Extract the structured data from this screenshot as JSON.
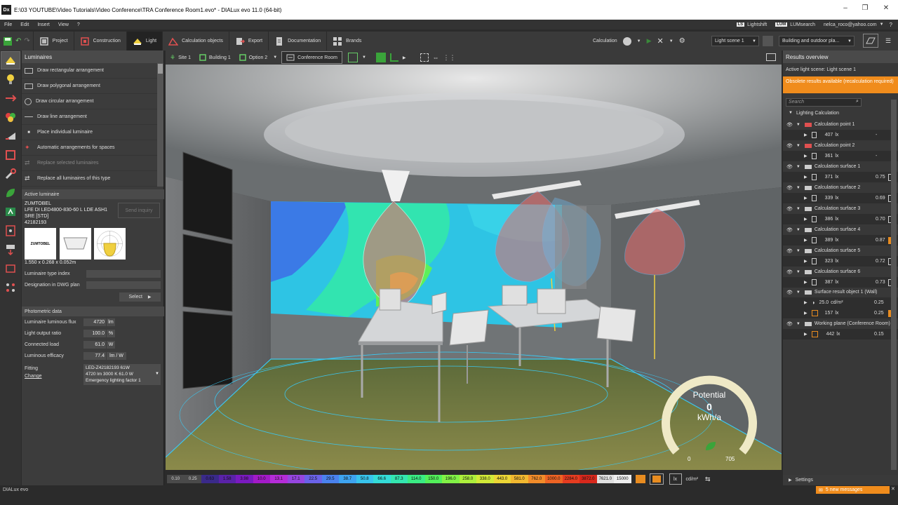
{
  "titlebar": {
    "logo": "Dx",
    "title": "E:\\03 YOUTUBE\\Video Tutorials\\Video Conference\\TRA Conference Room1.evo* - DIALux evo 11.0 (64-bit)"
  },
  "menu": {
    "items": [
      "File",
      "Edit",
      "Insert",
      "View",
      "?"
    ],
    "lightshift_badge": "LS",
    "lightshift": "Lightshift",
    "lumsearch_badge": "LUM",
    "lumsearch": "LUMsearch",
    "user": "nelca_roco@yahoo.com"
  },
  "toolbar": {
    "tabs": [
      {
        "label": "Project"
      },
      {
        "label": "Construction"
      },
      {
        "label": "Light"
      },
      {
        "label": "Calculation objects"
      },
      {
        "label": "Export"
      },
      {
        "label": "Documentation"
      },
      {
        "label": "Brands"
      }
    ],
    "calculation": "Calculation",
    "light_scene": "Light scene 1",
    "mode": "Building and outdoor pla..."
  },
  "luminaires": {
    "header": "Luminaires",
    "actions": [
      "Draw rectangular arrangement",
      "Draw polygonal arrangement",
      "Draw circular arrangement",
      "Draw line arrangement",
      "Place individual luminaire",
      "Automatic arrangements for spaces",
      "Replace selected luminaires",
      "Replace all luminaires of this type"
    ],
    "active_header": "Active luminaire",
    "manufacturer": "ZUMTOBEL",
    "model_line1": "LFE DI LED4800-830-60 L LDE ASH1",
    "model_line2": "SRE [STD]",
    "article": "42182193",
    "send_inquiry": "Send inquiry",
    "logo_text": "ZUMTOBEL",
    "dimensions": "1.550 x 0.268 x 0.052m",
    "type_index_label": "Luminaire type index",
    "designation_label": "Designation in DWG plan",
    "select": "Select",
    "photometric_header": "Photometric data",
    "flux_label": "Luminaire luminous flux",
    "flux": "4720",
    "flux_unit": "lm",
    "lor_label": "Light output ratio",
    "lor": "100.0",
    "lor_unit": "%",
    "load_label": "Connected load",
    "load": "61.0",
    "load_unit": "W",
    "efficacy_label": "Luminous efficacy",
    "efficacy": "77.4",
    "efficacy_unit": "lm / W",
    "fitting_label": "Fitting",
    "change": "Change",
    "fitting_line1": "LED-Z42182193  61W",
    "fitting_line2": "4720 lm  3000 K  61.0 W",
    "fitting_line3": "Emergency lighting factor  1"
  },
  "viewbar": {
    "site": "Site 1",
    "building": "Building 1",
    "option": "Option 2",
    "room": "Conference Room"
  },
  "gauge": {
    "title": "Potential",
    "value": "0",
    "unit": "kWh/a",
    "min": "0",
    "max": "705",
    "level": 0
  },
  "colorbar": {
    "values": [
      "0.10",
      "0.25",
      "0.63",
      "1.58",
      "3.98",
      "10.0",
      "13.1",
      "17.1",
      "22.5",
      "29.5",
      "38.7",
      "50.8",
      "66.6",
      "87.3",
      "114.0",
      "150.0",
      "196.0",
      "258.0",
      "338.0",
      "443.0",
      "581.0",
      "762.0",
      "1000.0",
      "2284.0",
      "3872.0",
      "7621.0",
      "15000"
    ],
    "colors": [
      "#4a4a4a",
      "#4a4a4a",
      "#3a2a8a",
      "#5a22a8",
      "#7a1ac0",
      "#a31ac8",
      "#b52cd8",
      "#9646e0",
      "#6a62e8",
      "#4a82ee",
      "#3ea4f0",
      "#38c4ec",
      "#34dcd8",
      "#34e6b0",
      "#3aec84",
      "#52f05a",
      "#82f246",
      "#aef03c",
      "#d2ea38",
      "#ecd636",
      "#f2b830",
      "#f28c2a",
      "#ee6424",
      "#e63c20",
      "#d8281c",
      "#e0e0e0",
      "#eeeeee"
    ],
    "unit_lx": "lx",
    "unit_cd": "cd/m²"
  },
  "results": {
    "header": "Results overview",
    "active_scene": "Active light scene: Light scene 1",
    "obsolete": "Obsolete results available (recalculation required)",
    "search_placeholder": "Search",
    "group": "Lighting Calculation",
    "items": [
      {
        "name": "Calculation point 1",
        "value": "407",
        "unit": "lx",
        "ratio": "-",
        "status": "none"
      },
      {
        "name": "Calculation point 2",
        "value": "361",
        "unit": "lx",
        "ratio": "-",
        "status": "none"
      },
      {
        "name": "Calculation surface 1",
        "value": "371",
        "unit": "lx",
        "ratio": "0.75",
        "status": "ok"
      },
      {
        "name": "Calculation surface 2",
        "value": "339",
        "unit": "lx",
        "ratio": "0.69",
        "status": "ok"
      },
      {
        "name": "Calculation surface 3",
        "value": "386",
        "unit": "lx",
        "ratio": "0.70",
        "status": "ok"
      },
      {
        "name": "Calculation surface 4",
        "value": "389",
        "unit": "lx",
        "ratio": "0.87",
        "status": "warn"
      },
      {
        "name": "Calculation surface 5",
        "value": "323",
        "unit": "lx",
        "ratio": "0.72",
        "status": "ok"
      },
      {
        "name": "Calculation surface 6",
        "value": "387",
        "unit": "lx",
        "ratio": "0.73",
        "status": "ok"
      }
    ],
    "surface_result": {
      "name": "Surface result object 1 (Wall)",
      "lum_value": "25.0",
      "lum_unit": "cd/m²",
      "lum_ratio": "0.25",
      "ill_value": "157",
      "ill_unit": "lx",
      "ill_ratio": "0.25"
    },
    "working_plane": {
      "name": "Working plane (Conference Room)",
      "value": "442",
      "unit": "lx",
      "ratio": "0.15"
    },
    "settings": "Settings"
  },
  "status": {
    "brand": "DIALux evo",
    "messages": "5 new messages"
  }
}
